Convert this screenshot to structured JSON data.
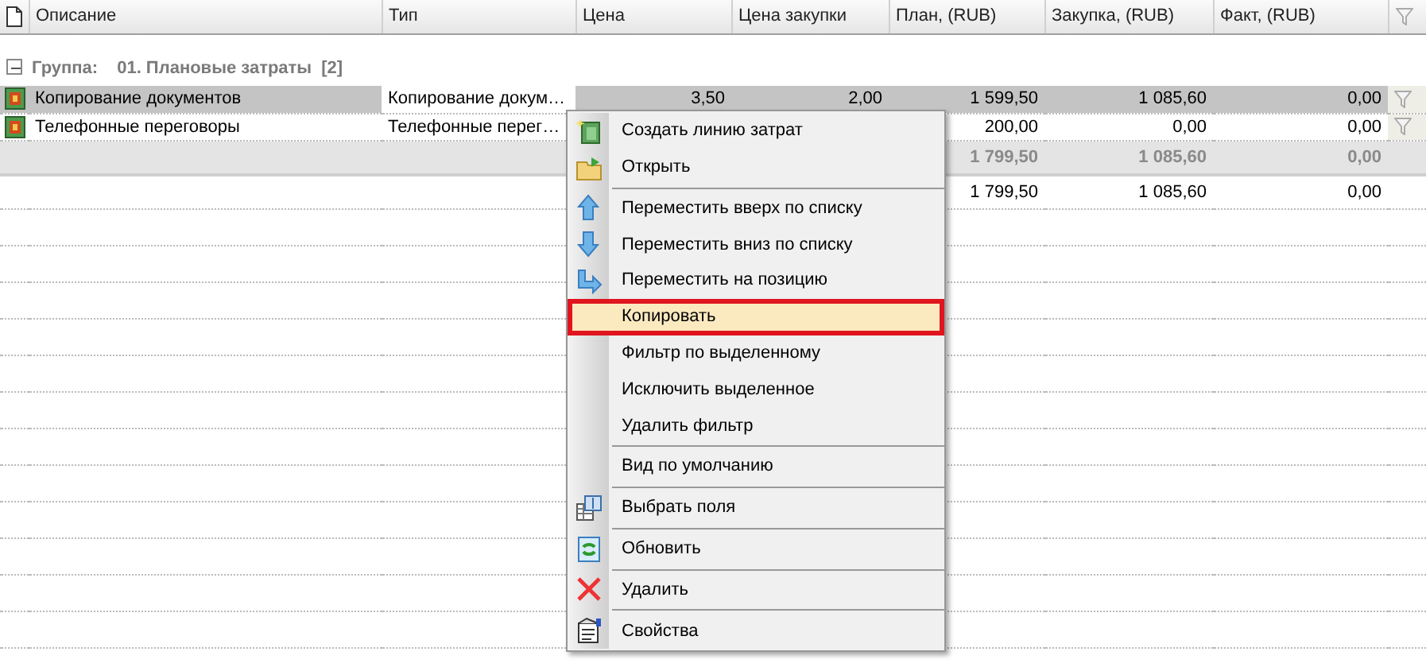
{
  "table": {
    "columns": [
      "Описание",
      "Тип",
      "Цена",
      "Цена закупки",
      "План, (RUB)",
      "Закупка, (RUB)",
      "Факт, (RUB)"
    ],
    "group": {
      "label": "Группа:",
      "name": "01. Плановые затраты",
      "count": "[2]",
      "expanded": true
    },
    "rows": [
      {
        "cells": [
          "Копирование документов",
          "Копирование докум…",
          "3,50",
          "2,00",
          "1 599,50",
          "1 085,60",
          "0,00"
        ],
        "selected": true
      },
      {
        "cells": [
          "Телефонные переговоры",
          "Телефонные перег…",
          "",
          "",
          "200,00",
          "0,00",
          "0,00"
        ],
        "selected": false
      }
    ],
    "subtotal": [
      "1 799,50",
      "1 085,60",
      "0,00"
    ],
    "total": [
      "1 799,50",
      "1 085,60",
      "0,00"
    ]
  },
  "context_menu": {
    "items": [
      {
        "label": "Создать линию затрат",
        "selected": false,
        "separator_after": false
      },
      {
        "label": "Открыть",
        "selected": false,
        "separator_after": true
      },
      {
        "label": "Переместить вверх по списку",
        "selected": false,
        "separator_after": false
      },
      {
        "label": "Переместить вниз по списку",
        "selected": false,
        "separator_after": false
      },
      {
        "label": "Переместить на позицию",
        "selected": false,
        "separator_after": false
      },
      {
        "label": "Копировать",
        "selected": true,
        "separator_after": false
      },
      {
        "label": "Фильтр по выделенному",
        "selected": false,
        "separator_after": false
      },
      {
        "label": "Исключить выделенное",
        "selected": false,
        "separator_after": false
      },
      {
        "label": "Удалить фильтр",
        "selected": false,
        "separator_after": true
      },
      {
        "label": "Вид по умолчанию",
        "selected": false,
        "separator_after": true
      },
      {
        "label": "Выбрать поля",
        "selected": false,
        "separator_after": true
      },
      {
        "label": "Обновить",
        "selected": false,
        "separator_after": true
      },
      {
        "label": "Удалить",
        "selected": false,
        "separator_after": true
      },
      {
        "label": "Свойства",
        "selected": false,
        "separator_after": false
      }
    ]
  }
}
